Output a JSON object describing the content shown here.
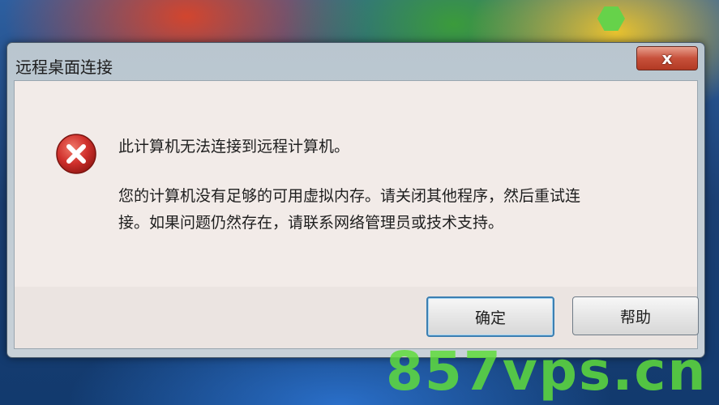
{
  "window": {
    "title": "远程桌面连接",
    "close_symbol": "x"
  },
  "message": {
    "icon": "error-icon",
    "main": "此计算机无法连接到远程计算机。",
    "detail_line1": "您的计算机没有足够的可用虚拟内存。请关闭其他程序，然后重试连",
    "detail_line2": "接。如果问题仍然存在，请联系网络管理员或技术支持。"
  },
  "buttons": {
    "ok_label": "确定",
    "help_label": "帮助"
  },
  "watermark": "857vps.cn",
  "colors": {
    "close_button": "#c7503a",
    "dialog_body": "#f2ebe8",
    "ok_focus_border": "#3c7fb1",
    "error_red": "#d0312d",
    "watermark_green": "#5fdc3c"
  }
}
